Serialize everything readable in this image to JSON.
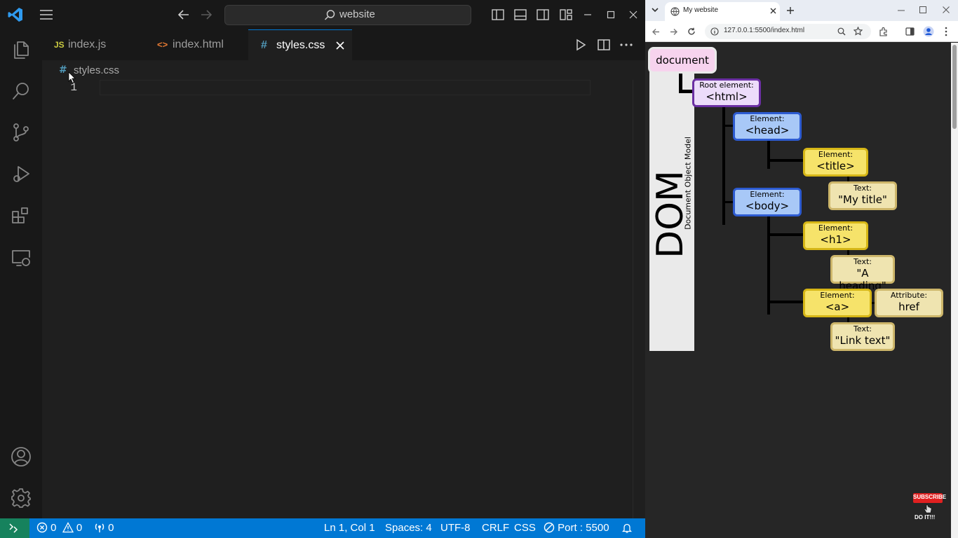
{
  "titlebar": {
    "search": "website"
  },
  "tabs": [
    {
      "label": "index.js",
      "icon": "JS"
    },
    {
      "label": "index.html",
      "icon": "<>"
    },
    {
      "label": "styles.css",
      "icon": "#"
    }
  ],
  "editor": {
    "breadcrumb": "styles.css",
    "line_number": "1"
  },
  "statusbar": {
    "errors": "0",
    "warnings": "0",
    "ports": "0",
    "position": "Ln 1, Col 1",
    "spaces": "Spaces: 4",
    "encoding": "UTF-8",
    "eol": "CRLF",
    "language": "CSS",
    "port": "Port : 5500"
  },
  "browser": {
    "tab_title": "My website",
    "url": "127.0.0.1:5500/index.html"
  },
  "dom": {
    "sidebar_title": "DOM",
    "sidebar_subtitle": "Document Object Model",
    "document": "document",
    "root": {
      "k": "Root element:",
      "v": "<html>"
    },
    "head": {
      "k": "Element:",
      "v": "<head>"
    },
    "title": {
      "k": "Element:",
      "v": "<title>"
    },
    "title_text": {
      "k": "Text:",
      "v": "\"My title\""
    },
    "body": {
      "k": "Element:",
      "v": "<body>"
    },
    "h1": {
      "k": "Element:",
      "v": "<h1>"
    },
    "h1_text": {
      "k": "Text:",
      "v": "\"A heading\""
    },
    "a": {
      "k": "Element:",
      "v": "<a>"
    },
    "attr": {
      "k": "Attribute:",
      "v": "href"
    },
    "a_text": {
      "k": "Text:",
      "v": "\"Link text\""
    }
  },
  "overlay": {
    "subscribe": "SUBSCRIBE",
    "doit": "DO IT!!!"
  },
  "colors": {
    "statusbar": "#0078d4",
    "accent": "#3794ff"
  }
}
